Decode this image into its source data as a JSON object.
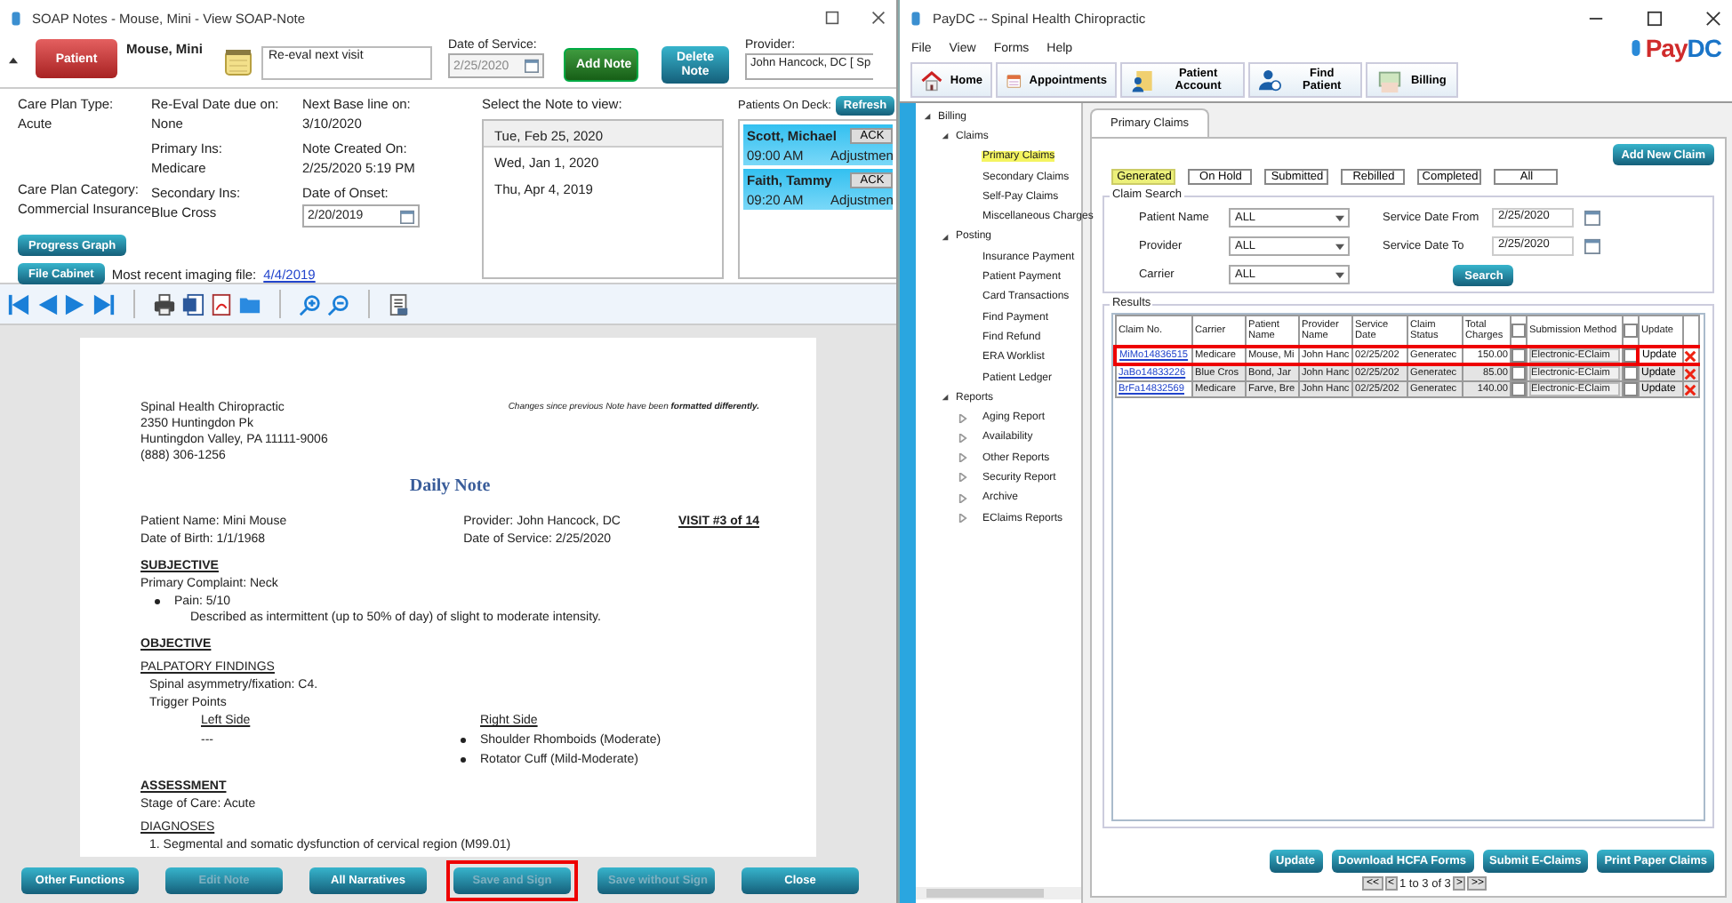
{
  "soap_window": {
    "title": "SOAP Notes - Mouse, Mini - View SOAP-Note",
    "patient_button": "Patient",
    "patient_name": "Mouse, Mini",
    "memo": "Re-eval next visit",
    "date_of_service": {
      "label": "Date of Service:",
      "value": "2/25/2020",
      "disabled": true
    },
    "add_note": "Add Note",
    "delete_note": "Delete Note",
    "provider": {
      "label": "Provider:",
      "value": "John Hancock, DC [ Sp"
    },
    "info_columns": [
      [
        {
          "label": "Care Plan Type:",
          "value": "Acute"
        },
        {
          "label": "Care Plan Category:",
          "value": "Commercial Insurance"
        }
      ],
      [
        {
          "label": "Re-Eval Date due on:",
          "value": "None"
        },
        {
          "label": "Primary Ins:",
          "value": "Medicare"
        },
        {
          "label": "Secondary Ins:",
          "value": "Blue Cross"
        }
      ],
      [
        {
          "label": "Next Base line on:",
          "value": "3/10/2020"
        },
        {
          "label": "Note Created On:",
          "value": "2/25/2020 5:19 PM"
        },
        {
          "label": "Date of Onset:",
          "value": "2/20/2019",
          "kind": "date"
        }
      ]
    ],
    "progress_graph": "Progress Graph",
    "file_cabinet": "File Cabinet",
    "imaging": {
      "label": "Most recent imaging file:",
      "link": "4/4/2019"
    },
    "notes": {
      "label": "Select the Note to view:",
      "items": [
        {
          "date": "Tue, Feb 25, 2020",
          "selected": true
        },
        {
          "date": "Wed, Jan 1, 2020",
          "selected": false
        },
        {
          "date": "Thu, Apr 4, 2019",
          "selected": false
        }
      ]
    },
    "on_deck": {
      "label": "Patients On Deck:",
      "refresh": "Refresh",
      "patients": [
        {
          "name": "Scott, Michael",
          "time": "09:00 AM",
          "ack": "ACK",
          "status": "Adjustmen"
        },
        {
          "name": "Faith, Tammy",
          "time": "09:20 AM",
          "ack": "ACK",
          "status": "Adjustmen"
        }
      ]
    },
    "document": {
      "practice": [
        "Spinal Health Chiropractic",
        "2350 Huntingdon Pk",
        "Huntingdon Valley, PA 11111-9006",
        "(888) 306-1256"
      ],
      "changes_note": "Changes since previous Note have been **formatted differently.**",
      "title": "Daily Note",
      "patient_lines": [
        "Patient Name: Mini Mouse",
        "Date of Birth: 1/1/1968"
      ],
      "provider_lines": [
        "Provider: John Hancock, DC",
        "Date of Service: 2/25/2020"
      ],
      "visit": "VISIT #3 of 14",
      "body": [
        {
          "kind": "heading",
          "text": "SUBJECTIVE"
        },
        {
          "kind": "line",
          "text": "Primary Complaint: Neck"
        },
        {
          "kind": "bullet",
          "text": "Pain: 5/10",
          "detail": "Described as intermittent (up to 50% of day) of slight to moderate intensity."
        },
        {
          "kind": "heading",
          "text": "OBJECTIVE"
        },
        {
          "kind": "subheading",
          "text": "PALPATORY FINDINGS"
        },
        {
          "kind": "indent",
          "text": "Spinal asymmetry/fixation: C4."
        },
        {
          "kind": "indent",
          "text": "Trigger Points"
        },
        {
          "kind": "sides",
          "left_title": "Left Side",
          "left_text": "---",
          "right_title": "Right Side",
          "right_items": [
            "Shoulder Rhomboids (Moderate)",
            "Rotator Cuff (Mild-Moderate)"
          ]
        },
        {
          "kind": "heading",
          "text": "ASSESSMENT"
        },
        {
          "kind": "line",
          "text": "Stage of Care: Acute"
        },
        {
          "kind": "subheading",
          "text": "DIAGNOSES"
        },
        {
          "kind": "indent",
          "text": "1. Segmental and somatic dysfunction of cervical region (M99.01)"
        }
      ]
    },
    "bottom_buttons": [
      {
        "label": "Other Functions",
        "disabled": false,
        "highlighted": false
      },
      {
        "label": "Edit Note",
        "disabled": true,
        "highlighted": false
      },
      {
        "label": "All Narratives",
        "disabled": false,
        "highlighted": false
      },
      {
        "label": "Save and Sign",
        "disabled": true,
        "highlighted": true
      },
      {
        "label": "Save without Sign",
        "disabled": true,
        "highlighted": false
      },
      {
        "label": "Close",
        "disabled": false,
        "highlighted": false
      }
    ]
  },
  "paydc_window": {
    "title": "PayDC -- Spinal Health Chiropractic",
    "menu": [
      "File",
      "View",
      "Forms",
      "Help"
    ],
    "logo": {
      "first": "Pay",
      "second": "DC"
    },
    "toolbar": [
      "Home",
      "Appointments",
      "Patient Account",
      "Find Patient",
      "Billing"
    ],
    "tree": [
      {
        "label": "Billing",
        "expanded": true,
        "children": [
          {
            "label": "Claims",
            "expanded": true,
            "children": [
              {
                "label": "Primary Claims",
                "selected": true
              },
              {
                "label": "Secondary Claims",
                "selected": false
              },
              {
                "label": "Self-Pay Claims",
                "selected": false
              },
              {
                "label": "Miscellaneous Charges",
                "selected": false
              }
            ]
          },
          {
            "label": "Posting",
            "expanded": true,
            "children": [
              {
                "label": "Insurance Payment",
                "selected": false
              },
              {
                "label": "Patient Payment",
                "selected": false
              },
              {
                "label": "Card Transactions",
                "selected": false
              },
              {
                "label": "Find Payment",
                "selected": false
              },
              {
                "label": "Find Refund",
                "selected": false
              },
              {
                "label": "ERA Worklist",
                "selected": false
              },
              {
                "label": "Patient Ledger",
                "selected": false
              }
            ]
          },
          {
            "label": "Reports",
            "expanded": true,
            "children": [
              {
                "label": "Aging Report",
                "expanded": false,
                "selected": false
              },
              {
                "label": "Availability",
                "expanded": false,
                "selected": false
              },
              {
                "label": "Other Reports",
                "expanded": false,
                "selected": false
              },
              {
                "label": "Security Report",
                "expanded": false,
                "selected": false
              },
              {
                "label": "Archive",
                "expanded": false,
                "selected": false
              },
              {
                "label": "EClaims Reports",
                "expanded": false,
                "selected": false
              }
            ]
          }
        ]
      }
    ],
    "tab": "Primary Claims",
    "add_new_claim": "Add New Claim",
    "status_filters": [
      {
        "label": "Generated",
        "selected": true
      },
      {
        "label": "On Hold",
        "selected": false
      },
      {
        "label": "Submitted",
        "selected": false
      },
      {
        "label": "Rebilled",
        "selected": false
      },
      {
        "label": "Completed",
        "selected": false
      },
      {
        "label": "All",
        "selected": false
      }
    ],
    "claim_search": {
      "title": "Claim Search",
      "fields": [
        {
          "label": "Patient Name",
          "value": "ALL"
        },
        {
          "label": "Provider",
          "value": "ALL"
        },
        {
          "label": "Carrier",
          "value": "ALL"
        }
      ],
      "date_fields": [
        {
          "label": "Service Date From",
          "value": "2/25/2020"
        },
        {
          "label": "Service Date To",
          "value": "2/25/2020"
        }
      ],
      "search": "Search"
    },
    "results": {
      "title": "Results",
      "columns": [
        "Claim No.",
        "Carrier",
        "Patient Name",
        "Provider Name",
        "Service Date",
        "Claim Status",
        "Total Charges",
        "Submission Method",
        "Update"
      ],
      "select_all_checked": false,
      "update_all_checked": false,
      "rows": [
        {
          "claim_no": "MiMo14836515",
          "carrier": "Medicare",
          "patient": "Mouse, Mi",
          "provider": "John Hanc",
          "service_date": "02/25/202",
          "status": "Generatec",
          "charges": "150.00",
          "checked": false,
          "method": "Electronic-EClaim",
          "update_checked": false,
          "update": "Update",
          "highlighted": true
        },
        {
          "claim_no": "JaBo14833226",
          "carrier": "Blue Cros",
          "patient": "Bond, Jar",
          "provider": "John Hanc",
          "service_date": "02/25/202",
          "status": "Generatec",
          "charges": "85.00",
          "checked": false,
          "method": "Electronic-EClaim",
          "update_checked": false,
          "update": "Update",
          "highlighted": false
        },
        {
          "claim_no": "BrFa14832569",
          "carrier": "Medicare",
          "patient": "Farve, Bre",
          "provider": "John Hanc",
          "service_date": "02/25/202",
          "status": "Generatec",
          "charges": "140.00",
          "checked": false,
          "method": "Electronic-EClaim",
          "update_checked": false,
          "update": "Update",
          "highlighted": false
        }
      ]
    },
    "actions": [
      "Update",
      "Download HCFA Forms",
      "Submit E-Claims",
      "Print Paper Claims"
    ],
    "pager": {
      "first": "<<",
      "prev": "<",
      "text": "1 to 3 of 3",
      "next": ">",
      "last": ">>"
    }
  }
}
